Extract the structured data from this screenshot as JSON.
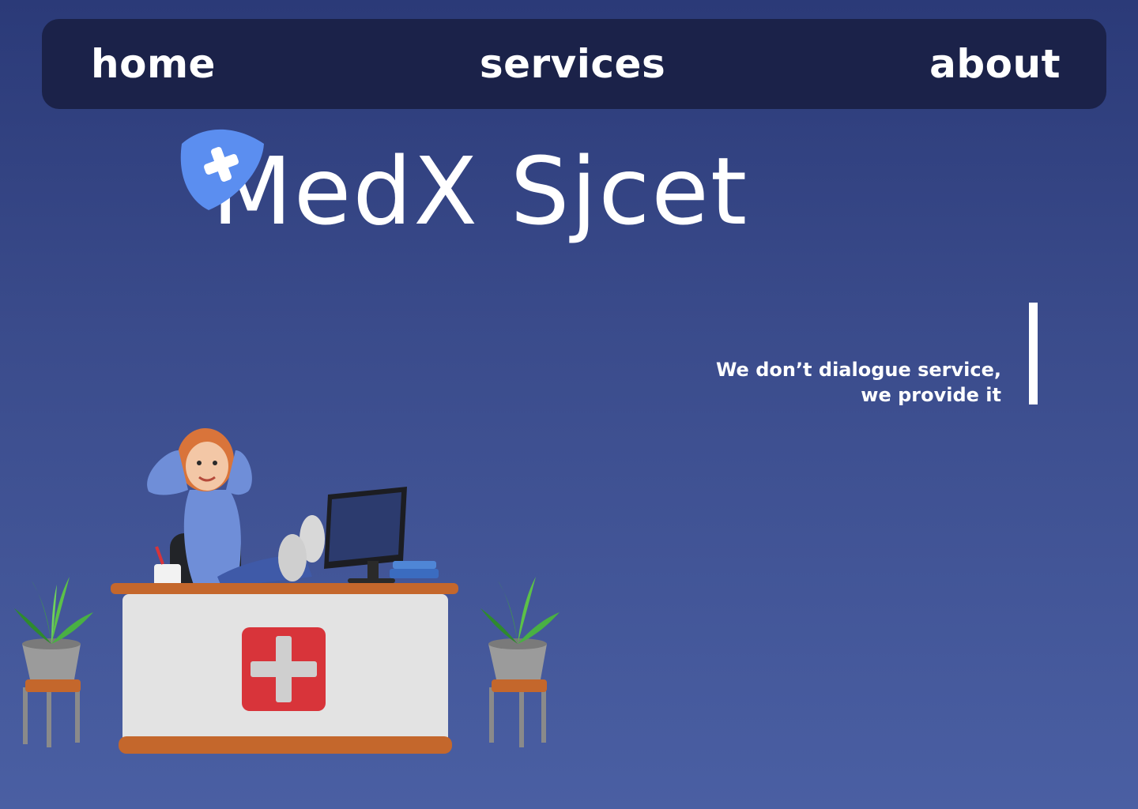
{
  "nav": {
    "items": [
      {
        "label": "home"
      },
      {
        "label": "services"
      },
      {
        "label": "about"
      }
    ]
  },
  "hero": {
    "title": "MedX Sjcet",
    "tagline_line1": "We don’t dialogue service,",
    "tagline_line2": "we provide it"
  },
  "colors": {
    "background_top": "#2b3a78",
    "background_bottom": "#4a5fa3",
    "nav_bg": "#1b2249",
    "logo_blue": "#5b8ef0",
    "cross_red": "#d8343a"
  },
  "icons": {
    "logo": "medical-cross-badge-icon",
    "illustration": "receptionist-at-desk-illustration"
  }
}
